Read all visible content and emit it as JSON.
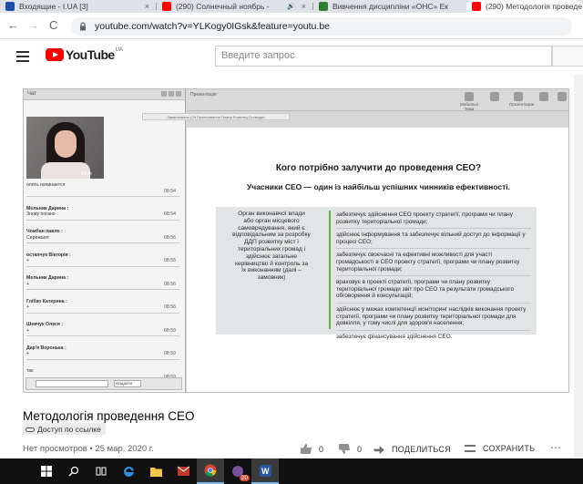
{
  "browser": {
    "tabs": [
      {
        "title": "Входящие - I.UA [3]",
        "favicon_color": "#1d4fa8"
      },
      {
        "title": "(290) Солнечный ноябрь - ",
        "favicon_color": "#ff0000",
        "audio": "🔊"
      },
      {
        "title": "Вивчення дисципліни «ОНС» Ек",
        "favicon_color": "#2e7d32"
      },
      {
        "title": "(290) Методологія проведе",
        "favicon_color": "#ff0000"
      }
    ],
    "close_glyph": "×",
    "back": "←",
    "forward": "→",
    "reload": "C",
    "url": "youtube.com/watch?v=YLKogy0IGsk&feature=youtu.be"
  },
  "youtube": {
    "logo_text": "YouTube",
    "region": "UA",
    "search_placeholder": "Введите запрос"
  },
  "video": {
    "chat": {
      "header": "Чат",
      "cam_name": "Юлія",
      "messages": [
        {
          "who": "",
          "text": "опять начинается",
          "time": "08:54"
        },
        {
          "who": "Мельник Дарина :",
          "text": "Знову погано",
          "time": "08:54"
        },
        {
          "who": "Чомбан павло :",
          "text": "Сережшот",
          "time": "08:56"
        },
        {
          "who": "остапчук Вікторія :",
          "text": "+",
          "time": "08:55"
        },
        {
          "who": "Мельник Дарина :",
          "text": "+",
          "time": "08:56"
        },
        {
          "who": "Глібко Катерина :",
          "text": "+",
          "time": "08:56"
        },
        {
          "who": "Шевчук Олеся :",
          "text": "+",
          "time": "08:59"
        },
        {
          "who": "Дар'я Воронька :",
          "text": "+",
          "time": "08:59"
        },
        {
          "who": "",
          "text": "так",
          "time": "08:59"
        }
      ],
      "input_select": "Наддати"
    },
    "presentation": {
      "header": "Презентація",
      "tools": [
        "Мобильні Теми",
        "",
        "Презентации",
        "",
        ""
      ],
      "bar_text": "Завантажено (25 Проєктування Плану Розвитку Громади)",
      "title": "Кого потрібно залучити до проведення СЕО?",
      "subtitle": "Учасники СЕО — один із найбільш успішних чинників ефективності.",
      "left_text": "Орган виконавчої влади або орган місцевого самоврядування, який є відповідальним за розробку ДДП розвитку міст і територіальних громад і здійснює загальне керівництво й контроль за їх виконанням (далі – замовник)",
      "right_items": [
        "забезпечує здійснення СЕО проекту стратегії, програми чи плану розвитку територіальної громади;",
        "здійснює інформування та забезпечує вільний доступ до інформації у процесі СЕО;",
        "забезпечує своєчасні та ефективні можливості для участі громадськості в СЕО проекту стратегії, програми чи плану розвитку територіальної громади;",
        "враховує в проекті стратегії, програми чи плану розвитку територіальної громади звіт про СЕО та результати громадського обговорення й консультацій;",
        "здійснює у межах компетенції моніторинг наслідків виконання проекту стратегії, програми чи плану розвитку територіальної громади для довкілля, у тому числі для здоров'я населення;",
        "забезпечує фінансування здійснення СЕО."
      ],
      "accent_color": "#5bb436"
    }
  },
  "details": {
    "title": "Методологія проведення СЕО",
    "access": "Доступ по ссылке",
    "meta": "Нет просмотров • 25 мар. 2020 г.",
    "likes": "0",
    "dislikes": "0",
    "share": "ПОДЕЛИТЬСЯ",
    "save": "СОХРАНИТЬ",
    "more": "⋯"
  },
  "taskbar": {
    "notification_badge": "20"
  }
}
